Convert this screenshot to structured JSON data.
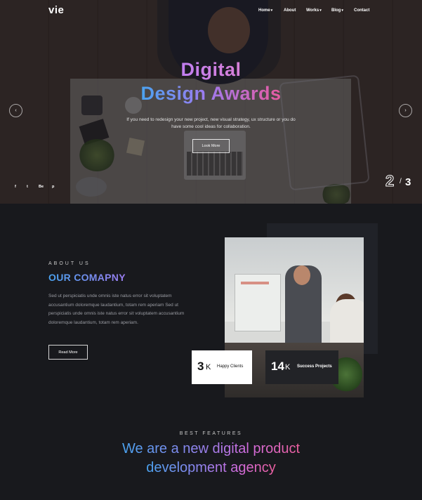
{
  "header": {
    "logo": "vie",
    "nav": [
      {
        "label": "Home",
        "dropdown": true
      },
      {
        "label": "About",
        "dropdown": false
      },
      {
        "label": "Works",
        "dropdown": true
      },
      {
        "label": "Blog",
        "dropdown": true
      },
      {
        "label": "Contact",
        "dropdown": false
      }
    ]
  },
  "hero": {
    "title_line1": "Digital",
    "title_line2": "Design Awards",
    "subtitle_line1": "If you need to redesign your new project, new visual strategy, ux structure or you do",
    "subtitle_line2": "have some cool ideas for collaboration.",
    "button_label": "Look More",
    "prev_arrow": "‹",
    "next_arrow": "›",
    "social": [
      "f",
      "t",
      "Be",
      "p"
    ],
    "slide_current": "2",
    "slide_separator": "/",
    "slide_total": "3"
  },
  "about": {
    "eyebrow": "ABOUT US",
    "title": "OUR COMAPNY",
    "body": "Sed ut perspiciatis unde omnis iste natus error sit voluptatem accusantium doloremque laudantium, totam rem aperiam Sed ut perspiciatis unde omnis iste natus error sit voluptatem accusantium doloremque laudantium, totam rem aperiam.",
    "button_label": "Read More",
    "stats": [
      {
        "number": "3",
        "unit": "K",
        "label": "Happy Clients"
      },
      {
        "number": "14",
        "unit": "K",
        "label": "Success Projects"
      }
    ]
  },
  "features": {
    "eyebrow": "BEST FEATURES",
    "title_line1": "We are a new digital product",
    "title_line2": "development agency"
  },
  "colors": {
    "background": "#18191d",
    "gradient_start": "#4aa3f0",
    "gradient_mid": "#9b7cf0",
    "gradient_end": "#e95aa0"
  }
}
